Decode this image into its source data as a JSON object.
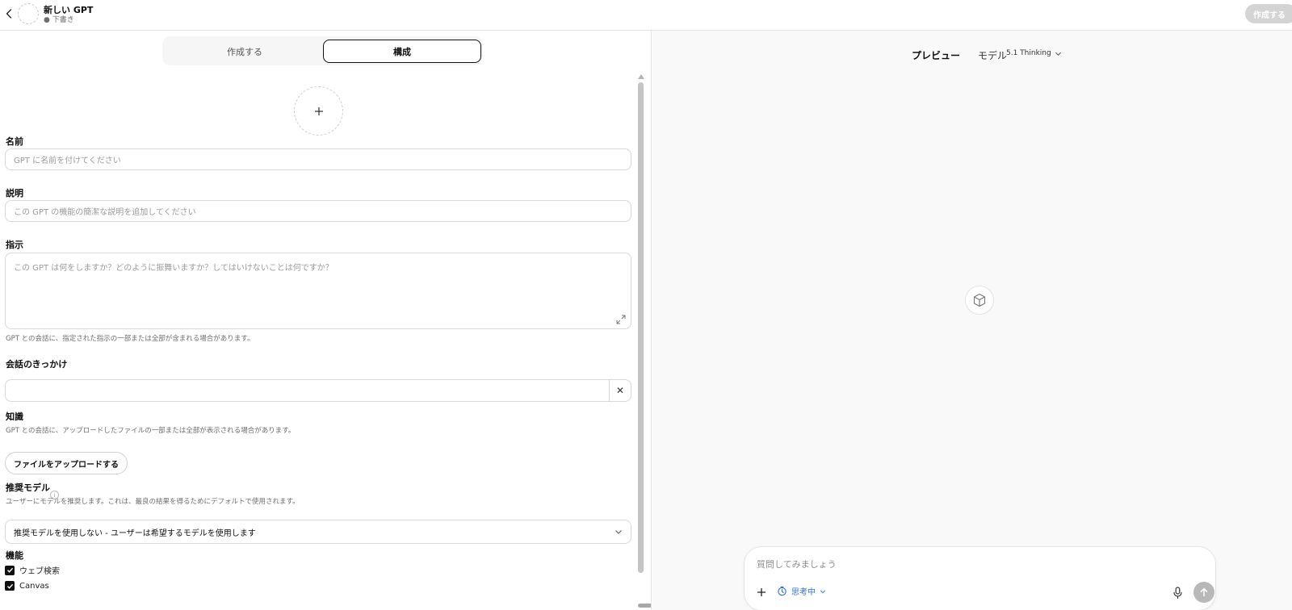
{
  "header": {
    "title": "新しい GPT",
    "status": "● 下書き",
    "create_button": "作成する"
  },
  "tabs": {
    "create": "作成する",
    "configure": "構成",
    "active": "configure"
  },
  "form": {
    "name": {
      "label": "名前",
      "placeholder": "GPT に名前を付けてください",
      "value": ""
    },
    "description": {
      "label": "説明",
      "placeholder": "この GPT の機能の簡潔な説明を追加してください",
      "value": ""
    },
    "instructions": {
      "label": "指示",
      "placeholder": "この GPT は何をしますか？どのように振舞いますか？してはいけないことは何ですか？",
      "hint": "GPT との会話に、指定された指示の一部または全部が含まれる場合があります。"
    },
    "conversation_starters": {
      "label": "会話のきっかけ",
      "value": "",
      "clear_symbol": "✕"
    },
    "knowledge": {
      "label": "知識",
      "hint": "GPT との会話に、アップロードしたファイルの一部または全部が表示される場合があります。",
      "upload_button": "ファイルをアップロードする"
    },
    "recommended_model": {
      "label": "推奨モデル",
      "info_symbol": "i",
      "hint": "ユーザーにモデルを推奨します。これは、最良の結果を得るためにデフォルトで使用されます。",
      "selected": "推奨モデルを使用しない - ユーザーは希望するモデルを使用します"
    },
    "capabilities": {
      "label": "機能",
      "items": [
        {
          "label": "ウェブ検索",
          "checked": true
        },
        {
          "label": "Canvas",
          "checked": true
        }
      ]
    }
  },
  "preview": {
    "title": "プレビュー",
    "model_label": "モデル",
    "model_value": "5.1 Thinking",
    "composer": {
      "placeholder": "質問してみましょう",
      "thinking_label": "思考中"
    }
  },
  "colors": {
    "accent_blue": "#2f6fdf",
    "border": "#d9d9d9",
    "preview_bg": "#f9f9f9"
  }
}
